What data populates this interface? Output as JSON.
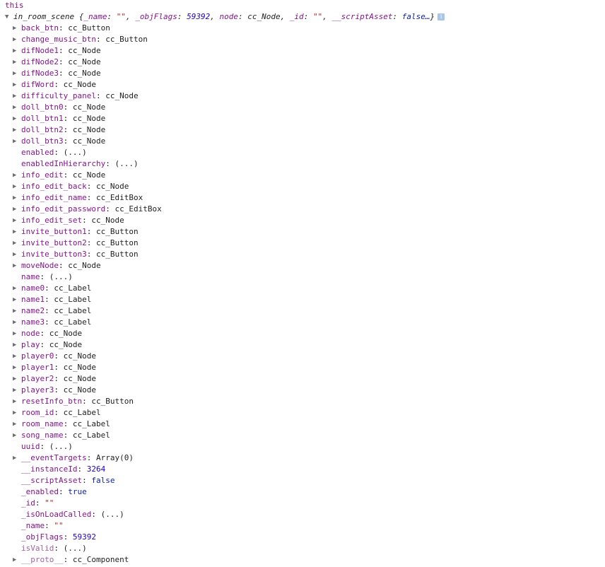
{
  "command": "this",
  "root": {
    "name": "in_room_scene",
    "preview": [
      {
        "key": "_name",
        "value": "\"\"",
        "kind": "str"
      },
      {
        "key": "_objFlags",
        "value": "59392",
        "kind": "num"
      },
      {
        "key": "node",
        "value": "cc_Node",
        "kind": "type"
      },
      {
        "key": "_id",
        "value": "\"\"",
        "kind": "str"
      },
      {
        "key": "__scriptAsset",
        "value": "false…",
        "kind": "bool"
      }
    ],
    "info_icon": "i"
  },
  "properties": [
    {
      "key": "back_btn",
      "value": "cc_Button",
      "expandable": true,
      "kind": "type"
    },
    {
      "key": "change_music_btn",
      "value": "cc_Button",
      "expandable": true,
      "kind": "type"
    },
    {
      "key": "difNode1",
      "value": "cc_Node",
      "expandable": true,
      "kind": "type"
    },
    {
      "key": "difNode2",
      "value": "cc_Node",
      "expandable": true,
      "kind": "type"
    },
    {
      "key": "difNode3",
      "value": "cc_Node",
      "expandable": true,
      "kind": "type"
    },
    {
      "key": "difWord",
      "value": "cc_Node",
      "expandable": true,
      "kind": "type"
    },
    {
      "key": "difficulty_panel",
      "value": "cc_Node",
      "expandable": true,
      "kind": "type"
    },
    {
      "key": "doll_btn0",
      "value": "cc_Node",
      "expandable": true,
      "kind": "type"
    },
    {
      "key": "doll_btn1",
      "value": "cc_Node",
      "expandable": true,
      "kind": "type"
    },
    {
      "key": "doll_btn2",
      "value": "cc_Node",
      "expandable": true,
      "kind": "type"
    },
    {
      "key": "doll_btn3",
      "value": "cc_Node",
      "expandable": true,
      "kind": "type"
    },
    {
      "key": "enabled",
      "value": "(...)",
      "expandable": false,
      "kind": "get"
    },
    {
      "key": "enabledInHierarchy",
      "value": "(...)",
      "expandable": false,
      "kind": "get"
    },
    {
      "key": "info_edit",
      "value": "cc_Node",
      "expandable": true,
      "kind": "type"
    },
    {
      "key": "info_edit_back",
      "value": "cc_Node",
      "expandable": true,
      "kind": "type"
    },
    {
      "key": "info_edit_name",
      "value": "cc_EditBox",
      "expandable": true,
      "kind": "type"
    },
    {
      "key": "info_edit_password",
      "value": "cc_EditBox",
      "expandable": true,
      "kind": "type"
    },
    {
      "key": "info_edit_set",
      "value": "cc_Node",
      "expandable": true,
      "kind": "type"
    },
    {
      "key": "invite_button1",
      "value": "cc_Button",
      "expandable": true,
      "kind": "type"
    },
    {
      "key": "invite_button2",
      "value": "cc_Button",
      "expandable": true,
      "kind": "type"
    },
    {
      "key": "invite_button3",
      "value": "cc_Button",
      "expandable": true,
      "kind": "type"
    },
    {
      "key": "moveNode",
      "value": "cc_Node",
      "expandable": true,
      "kind": "type"
    },
    {
      "key": "name",
      "value": "(...)",
      "expandable": false,
      "kind": "get"
    },
    {
      "key": "name0",
      "value": "cc_Label",
      "expandable": true,
      "kind": "type"
    },
    {
      "key": "name1",
      "value": "cc_Label",
      "expandable": true,
      "kind": "type"
    },
    {
      "key": "name2",
      "value": "cc_Label",
      "expandable": true,
      "kind": "type"
    },
    {
      "key": "name3",
      "value": "cc_Label",
      "expandable": true,
      "kind": "type"
    },
    {
      "key": "node",
      "value": "cc_Node",
      "expandable": true,
      "kind": "type"
    },
    {
      "key": "play",
      "value": "cc_Node",
      "expandable": true,
      "kind": "type"
    },
    {
      "key": "player0",
      "value": "cc_Node",
      "expandable": true,
      "kind": "type"
    },
    {
      "key": "player1",
      "value": "cc_Node",
      "expandable": true,
      "kind": "type"
    },
    {
      "key": "player2",
      "value": "cc_Node",
      "expandable": true,
      "kind": "type"
    },
    {
      "key": "player3",
      "value": "cc_Node",
      "expandable": true,
      "kind": "type"
    },
    {
      "key": "resetInfo_btn",
      "value": "cc_Button",
      "expandable": true,
      "kind": "type"
    },
    {
      "key": "room_id",
      "value": "cc_Label",
      "expandable": true,
      "kind": "type"
    },
    {
      "key": "room_name",
      "value": "cc_Label",
      "expandable": true,
      "kind": "type"
    },
    {
      "key": "song_name",
      "value": "cc_Label",
      "expandable": true,
      "kind": "type"
    },
    {
      "key": "uuid",
      "value": "(...)",
      "expandable": false,
      "kind": "get"
    },
    {
      "key": "__eventTargets",
      "value": "Array(0)",
      "expandable": true,
      "kind": "type"
    },
    {
      "key": "__instanceId",
      "value": "3264",
      "expandable": false,
      "kind": "num"
    },
    {
      "key": "__scriptAsset",
      "value": "false",
      "expandable": false,
      "kind": "bool"
    },
    {
      "key": "_enabled",
      "value": "true",
      "expandable": false,
      "kind": "bool"
    },
    {
      "key": "_id",
      "value": "\"\"",
      "expandable": false,
      "kind": "str"
    },
    {
      "key": "_isOnLoadCalled",
      "value": "(...)",
      "expandable": false,
      "kind": "get"
    },
    {
      "key": "_name",
      "value": "\"\"",
      "expandable": false,
      "kind": "str"
    },
    {
      "key": "_objFlags",
      "value": "59392",
      "expandable": false,
      "kind": "num"
    },
    {
      "key": "isValid",
      "value": "(...)",
      "expandable": false,
      "kind": "get",
      "dim": true
    },
    {
      "key": "__proto__",
      "value": "cc_Component",
      "expandable": true,
      "kind": "type",
      "dim": true
    }
  ]
}
